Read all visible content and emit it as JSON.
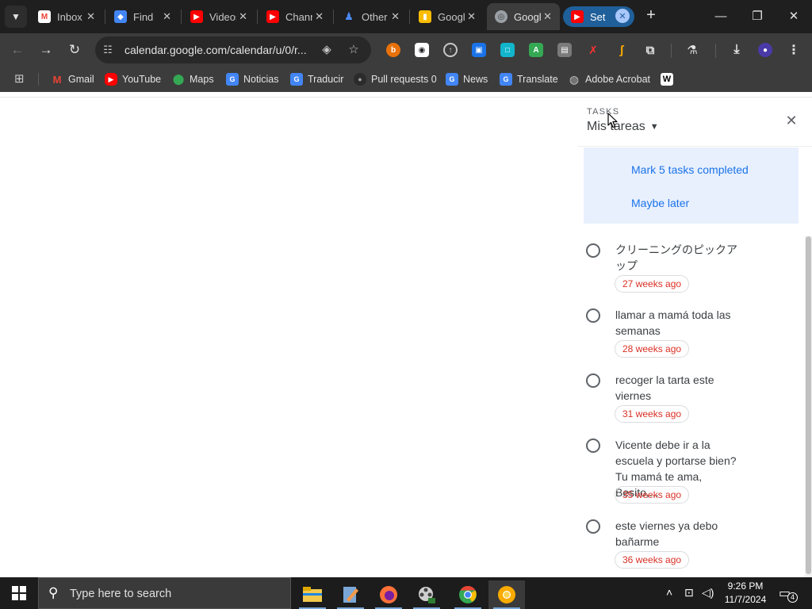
{
  "browser": {
    "tab_search_icon": "chevron-down-icon",
    "tabs": [
      {
        "label": "Inbox",
        "icon": "gmail",
        "color": "#ea4335"
      },
      {
        "label": "Find",
        "icon": "google-lens",
        "color": "#4285f4"
      },
      {
        "label": "Videos",
        "icon": "youtube",
        "color": "#ff0000"
      },
      {
        "label": "Channel",
        "icon": "youtube",
        "color": "#ff0000"
      },
      {
        "label": "Other",
        "icon": "person",
        "color": "#1a73e8"
      },
      {
        "label": "Google Keep",
        "icon": "keep",
        "color": "#fbbc04"
      },
      {
        "label": "Google",
        "icon": "globe",
        "color": "#9aa0a6"
      },
      {
        "label": "Set",
        "icon": "youtube",
        "color": "#ff0000"
      }
    ],
    "address_bar": {
      "url": "calendar.google.com/calendar/u/0/r..."
    },
    "bookmarks": [
      {
        "label": "Gmail",
        "icon": "gmail"
      },
      {
        "label": "YouTube",
        "icon": "youtube"
      },
      {
        "label": "Maps",
        "icon": "maps"
      },
      {
        "label": "Noticias",
        "icon": "news"
      },
      {
        "label": "Traducir",
        "icon": "translate"
      },
      {
        "label": "Pull requests 0",
        "icon": "github"
      },
      {
        "label": "News",
        "icon": "news"
      },
      {
        "label": "Translate",
        "icon": "translate"
      },
      {
        "label": "Adobe Acrobat",
        "icon": "globe"
      },
      {
        "label": "W",
        "icon": "wikipedia"
      }
    ]
  },
  "tasks_panel": {
    "overline": "TASKS",
    "list_name": "Mis tareas",
    "suggestion": {
      "primary_action": "Mark 5 tasks completed",
      "secondary_action": "Maybe later"
    },
    "tasks": [
      {
        "title": "クリーニングのピックアップ",
        "due": "27 weeks ago"
      },
      {
        "title": "llamar a mamá toda las semanas",
        "due": "28 weeks ago"
      },
      {
        "title": "recoger la tarta este viernes",
        "due": "31 weeks ago"
      },
      {
        "title": "Vicente debe ir a la escuela y portarse bien? Tu mamá te ama, Besito,...",
        "due": "35 weeks ago"
      },
      {
        "title": "este viernes ya debo bañarme",
        "due": "36 weeks ago"
      }
    ]
  },
  "taskbar": {
    "search_placeholder": "Type here to search",
    "time": "9:26 PM",
    "date": "11/7/2024",
    "notification_count": "4"
  },
  "colors": {
    "accent_link": "#1a73e8",
    "overdue": "#d93025",
    "suggestion_bg": "#e8f0fe"
  }
}
